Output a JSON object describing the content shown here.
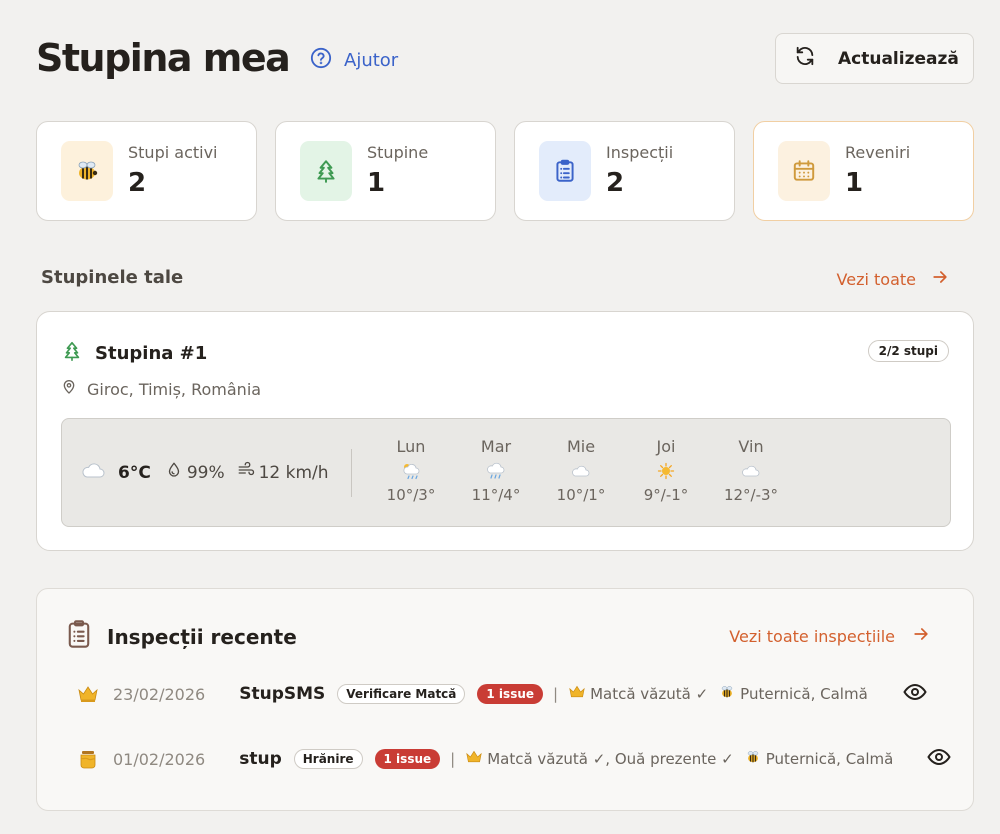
{
  "header": {
    "title": "Stupina mea",
    "help_label": "Ajutor",
    "refresh_label": "Actualizează"
  },
  "stats": [
    {
      "label": "Stupi activi",
      "value": "2",
      "icon": "bee-icon"
    },
    {
      "label": "Stupine",
      "value": "1",
      "icon": "tree-icon"
    },
    {
      "label": "Inspecții",
      "value": "2",
      "icon": "clipboard-icon"
    },
    {
      "label": "Reveniri",
      "value": "1",
      "icon": "calendar-icon"
    }
  ],
  "apiaries_section": {
    "title": "Stupinele tale",
    "see_all_label": "Vezi toate"
  },
  "apiary": {
    "name": "Stupina #1",
    "hive_badge": "2/2 stupi",
    "location": "Giroc, Timiș, România",
    "weather": {
      "temp": "6°C",
      "humidity": "99%",
      "wind": "12 km/h",
      "forecast": [
        {
          "day": "Lun",
          "range": "10°/3°",
          "icon": "cloud-sun-rain-icon"
        },
        {
          "day": "Mar",
          "range": "11°/4°",
          "icon": "cloud-rain-icon"
        },
        {
          "day": "Mie",
          "range": "10°/1°",
          "icon": "cloud-icon"
        },
        {
          "day": "Joi",
          "range": "9°/-1°",
          "icon": "sun-icon"
        },
        {
          "day": "Vin",
          "range": "12°/-3°",
          "icon": "cloud-icon"
        }
      ]
    }
  },
  "inspections": {
    "title": "Inspecții recente",
    "see_all_label": "Vezi toate inspecțiile",
    "rows": [
      {
        "icon": "crown-icon",
        "date": "23/02/2026",
        "hive": "StupSMS",
        "type": "Verificare Matcă",
        "issue": "1 issue",
        "details": [
          "Matcă văzută ✓",
          "Puternică, Calmă"
        ]
      },
      {
        "icon": "honey-jar-icon",
        "date": "01/02/2026",
        "hive": "stup",
        "type": "Hrănire",
        "issue": "1 issue",
        "details": [
          "Matcă văzută ✓, Ouă prezente ✓",
          "Puternică, Calmă"
        ]
      }
    ]
  },
  "colors": {
    "accent": "#d3602e",
    "link": "#3b63c9",
    "issue": "#c93c35",
    "background": "#f2f1ef"
  }
}
